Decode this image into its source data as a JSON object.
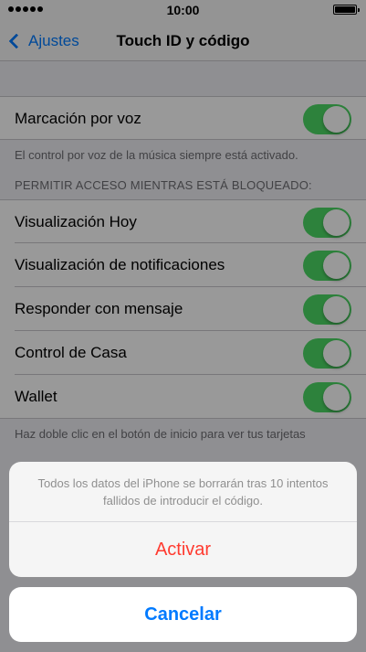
{
  "status_bar": {
    "time": "10:00",
    "signal_icon": "signal-dots-icon",
    "battery_icon": "battery-full-icon"
  },
  "nav": {
    "back_label": "Ajustes",
    "title": "Touch ID y código"
  },
  "voice": {
    "label": "Marcación por voz",
    "enabled": true,
    "footer": "El control por voz de la música siempre está activado."
  },
  "locked_access": {
    "header": "PERMITIR ACCESO MIENTRAS ESTÁ BLOQUEADO:",
    "items": [
      {
        "label": "Visualización Hoy",
        "enabled": true
      },
      {
        "label": "Visualización de notificaciones",
        "enabled": true
      },
      {
        "label": "Responder con mensaje",
        "enabled": true
      },
      {
        "label": "Control de Casa",
        "enabled": true
      },
      {
        "label": "Wallet",
        "enabled": true
      }
    ],
    "footer": "Haz doble clic en el botón de inicio para ver tus tarjetas"
  },
  "action_sheet": {
    "message": "Todos los datos del iPhone se borrarán tras 10 intentos fallidos de introducir el código.",
    "activate_label": "Activar",
    "cancel_label": "Cancelar"
  },
  "colors": {
    "toggle_on": "#4cd964",
    "tint": "#007aff",
    "destructive": "#ff3b30"
  }
}
